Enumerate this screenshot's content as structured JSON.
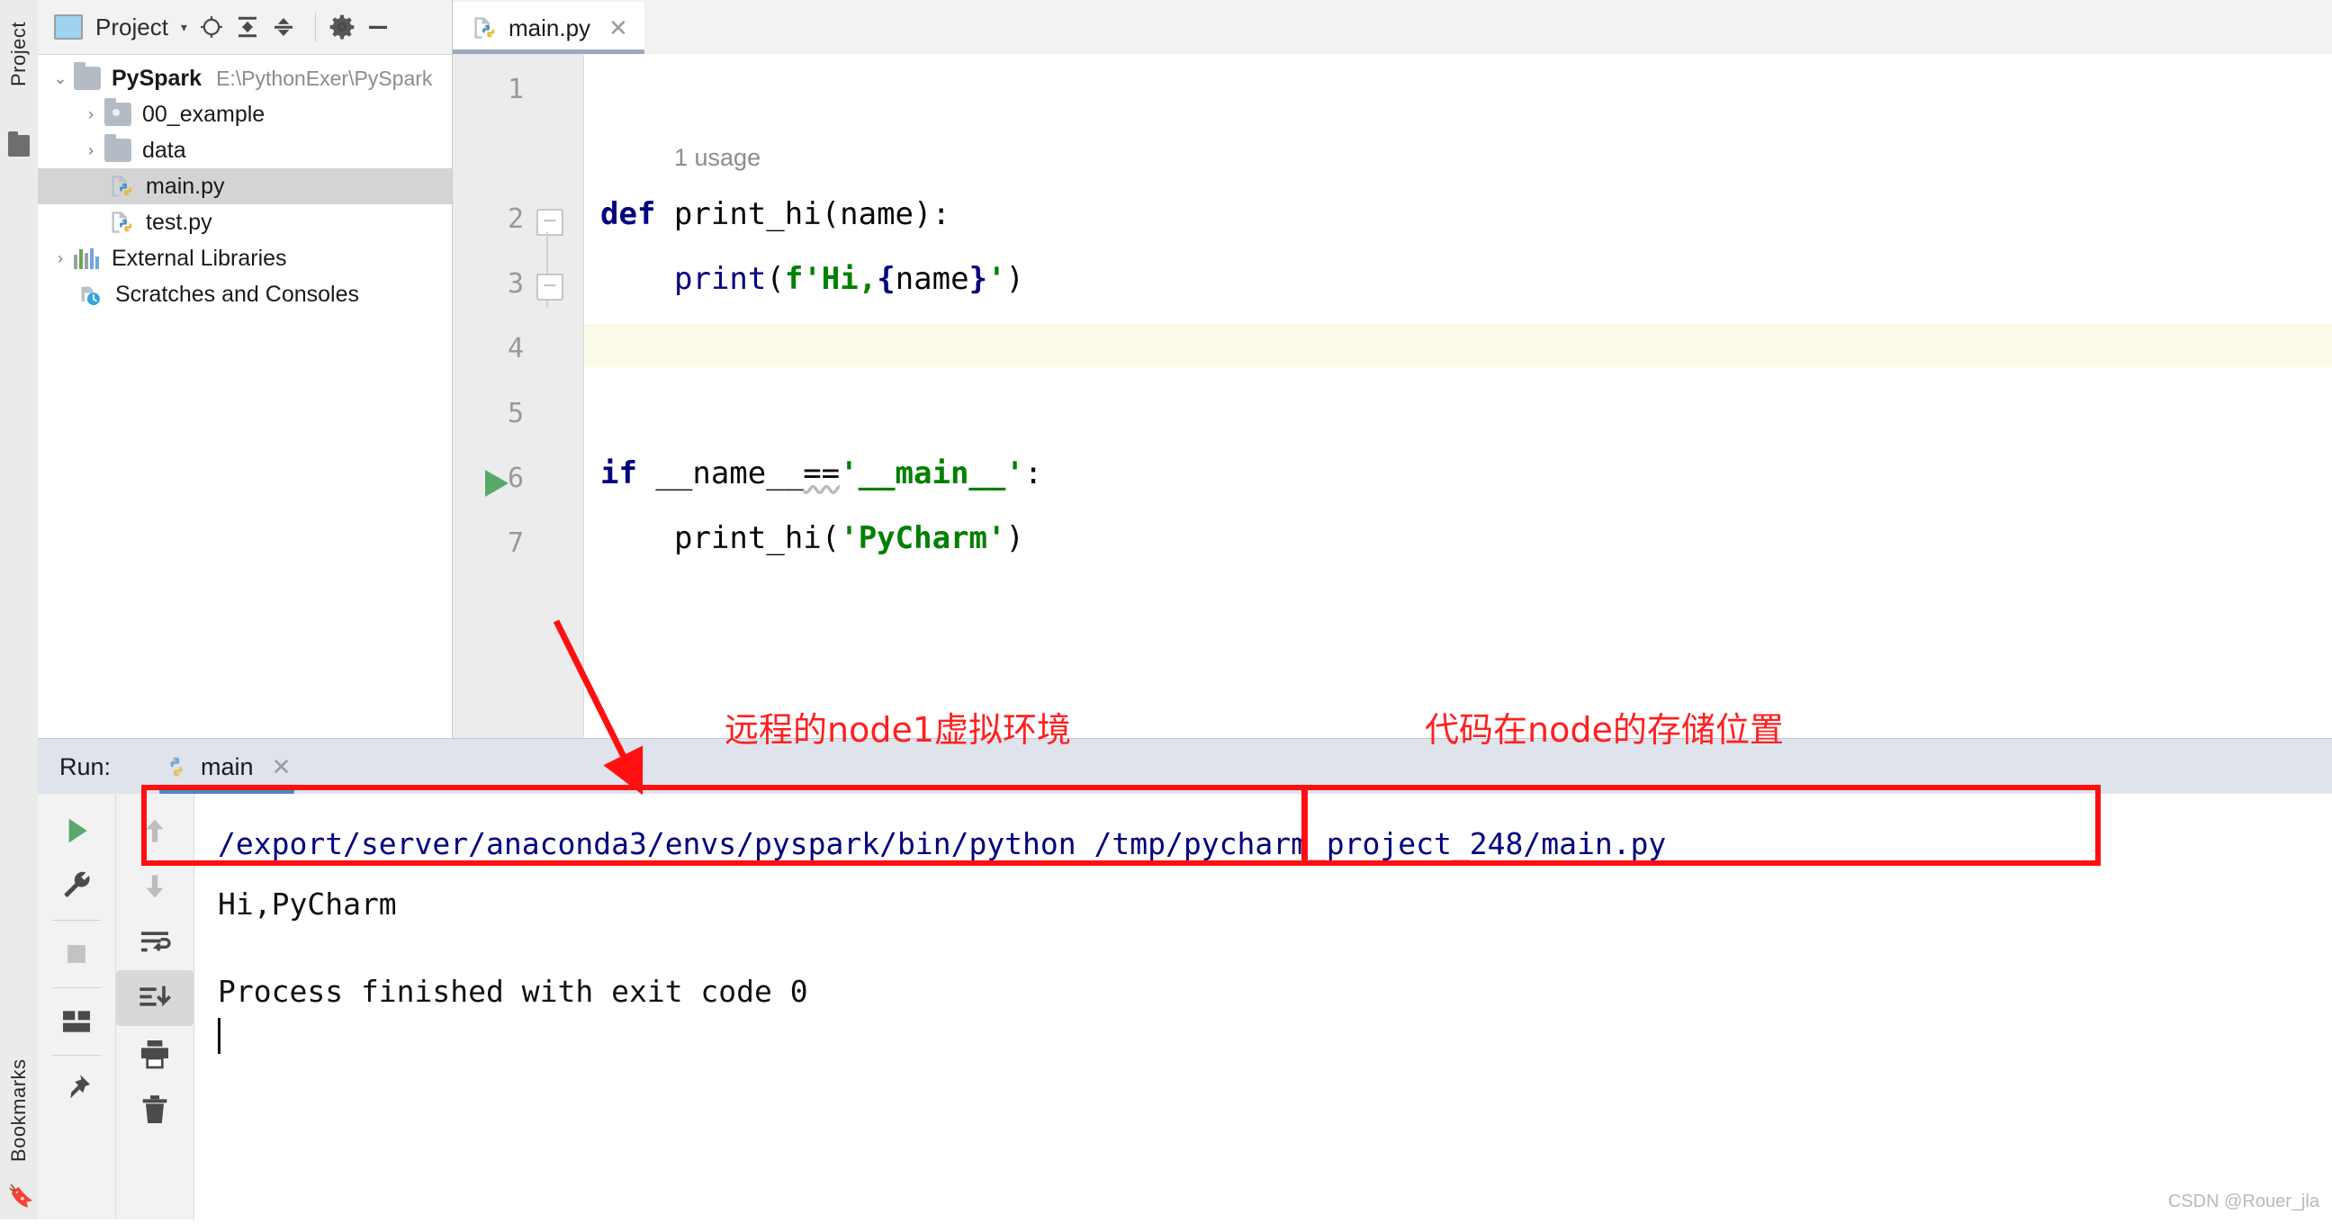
{
  "window": {
    "left_tool_tabs": [
      "Project",
      "Bookmarks"
    ]
  },
  "project_panel": {
    "title": "Project",
    "caret": "▾",
    "buttons": [
      {
        "name": "locate-icon",
        "glyph": "⊕"
      },
      {
        "name": "expand-all-icon",
        "glyph": "⤓"
      },
      {
        "name": "collapse-all-icon",
        "glyph": "⤒"
      },
      {
        "name": "settings-gear-icon",
        "glyph": "⚙"
      },
      {
        "name": "hide-icon",
        "glyph": "—"
      }
    ],
    "tree": [
      {
        "label": "PySpark",
        "path": "E:\\PythonExer\\PySpark",
        "arrow": "⌄",
        "icon": "folder",
        "bold": true,
        "selected": false,
        "indent": 0
      },
      {
        "label": "00_example",
        "path": "",
        "arrow": "›",
        "icon": "folder-dot",
        "bold": false,
        "selected": false,
        "indent": 1
      },
      {
        "label": "data",
        "path": "",
        "arrow": "›",
        "icon": "folder",
        "bold": false,
        "selected": false,
        "indent": 1
      },
      {
        "label": "main.py",
        "path": "",
        "arrow": "",
        "icon": "python-file",
        "bold": false,
        "selected": true,
        "indent": 2
      },
      {
        "label": "test.py",
        "path": "",
        "arrow": "",
        "icon": "python-file",
        "bold": false,
        "selected": false,
        "indent": 2
      },
      {
        "label": "External Libraries",
        "path": "",
        "arrow": "›",
        "icon": "libraries",
        "bold": false,
        "selected": false,
        "indent": 0
      },
      {
        "label": "Scratches and Consoles",
        "path": "",
        "arrow": "",
        "icon": "scratches",
        "bold": false,
        "selected": false,
        "indent": 0
      }
    ]
  },
  "editor": {
    "tab": {
      "label": "main.py",
      "close": "✕",
      "icon": "python-file"
    },
    "usage_hint": "1 usage",
    "line_numbers": [
      "1",
      "2",
      "3",
      "4",
      "5",
      "6",
      "7"
    ],
    "current_line": 4,
    "run_gutter_line": 6,
    "code_lines": [
      {
        "n": 1,
        "text": ""
      },
      {
        "n": 2,
        "text": "def print_hi(name):"
      },
      {
        "n": 3,
        "text": "    print(f'Hi,{name}')"
      },
      {
        "n": 4,
        "text": ""
      },
      {
        "n": 5,
        "text": ""
      },
      {
        "n": 6,
        "text": "if __name__=='__main__':"
      },
      {
        "n": 7,
        "text": "    print_hi('PyCharm')"
      }
    ],
    "tokens": {
      "def": "def",
      "fn_print_hi": "print_hi(name):",
      "print": "print",
      "fstring_open": "(f'Hi,",
      "brace_open": "{",
      "name_var": "name",
      "brace_close": "}",
      "fstring_close": "'",
      "paren_close": ")",
      "if": "if",
      "dunder_name": " __name__",
      "eq": "==",
      "main_str": "'__main__'",
      "colon": ":",
      "call_print_hi": "print_hi(",
      "pycharm_str": "'PyCharm'",
      "call_close": ")"
    }
  },
  "run_panel": {
    "label": "Run:",
    "tab": {
      "label": "main",
      "close": "✕",
      "icon": "python-file"
    },
    "toolbar_left": [
      {
        "name": "rerun-button",
        "glyph": "▶"
      },
      {
        "name": "edit-configurations-button",
        "glyph": "🔧"
      },
      {
        "name": "stop-button",
        "glyph": "■"
      },
      {
        "name": "layout-button",
        "glyph": "▦"
      },
      {
        "name": "pin-tab-button",
        "glyph": "📌"
      }
    ],
    "toolbar_right": [
      {
        "name": "up-the-stack-trace-button",
        "glyph": "↑"
      },
      {
        "name": "down-the-stack-trace-button",
        "glyph": "↓"
      },
      {
        "name": "soft-wrap-button",
        "glyph": "⏎"
      },
      {
        "name": "scroll-to-end-button",
        "glyph": "⤓",
        "active": true
      },
      {
        "name": "print-button",
        "glyph": "🖨"
      },
      {
        "name": "clear-all-button",
        "glyph": "🗑"
      }
    ],
    "console": {
      "interpreter_path": "/export/server/anaconda3/envs/pyspark/bin/python",
      "script_path": "/tmp/pycharm_project_248/main.py",
      "output_line": "Hi,PyCharm",
      "exit_line": "Process finished with exit code 0"
    }
  },
  "annotations": [
    {
      "name": "annotation-remote-env",
      "text": "远程的node1虚拟环境"
    },
    {
      "name": "annotation-code-location",
      "text": "代码在node的存储位置"
    }
  ],
  "watermark": "CSDN @Rouer_jla",
  "colors": {
    "accent_blue": "#4a88c7",
    "annotation_red": "#ff2020",
    "keyword_blue": "#000080",
    "string_green": "#008000",
    "run_green": "#59a869",
    "selection_gray": "#d4d4d4",
    "current_line_yellow": "#fcfbe9"
  }
}
